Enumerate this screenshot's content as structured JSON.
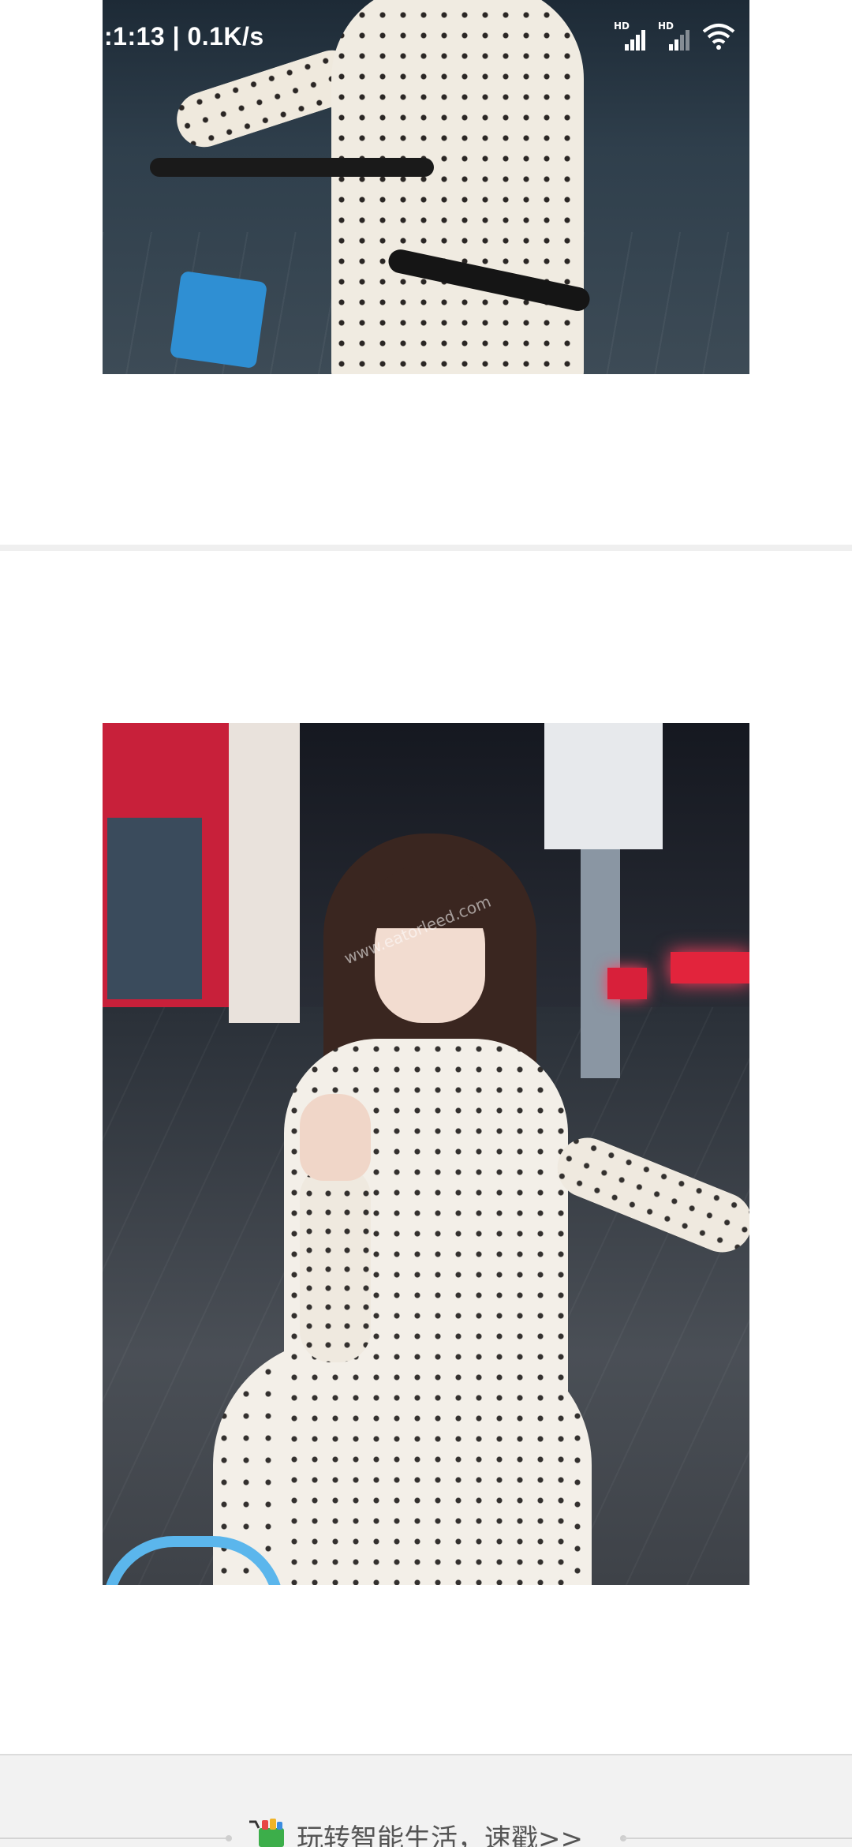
{
  "status_bar": {
    "time_speed": ":1:13 | 0.1K/s",
    "sim1_label": "HD",
    "sim2_label": "HD",
    "icons": [
      "signal-hd-icon",
      "signal-hd-weak-icon",
      "wifi-icon"
    ]
  },
  "images": {
    "top_photo": "street-photo-girl-polka-dot-dress-bicycle",
    "main_photo": "street-photo-girl-polka-dot-dress-peace-sign"
  },
  "watermark": "www.eatorleed.com",
  "footer": {
    "promo_text": "玩转智能生活，速戳>>",
    "promo_icon": "shopping-cart-icon"
  },
  "colors": {
    "divider": "#efefef",
    "footer_bg": "#f2f2f2",
    "promo_text": "#555555"
  }
}
